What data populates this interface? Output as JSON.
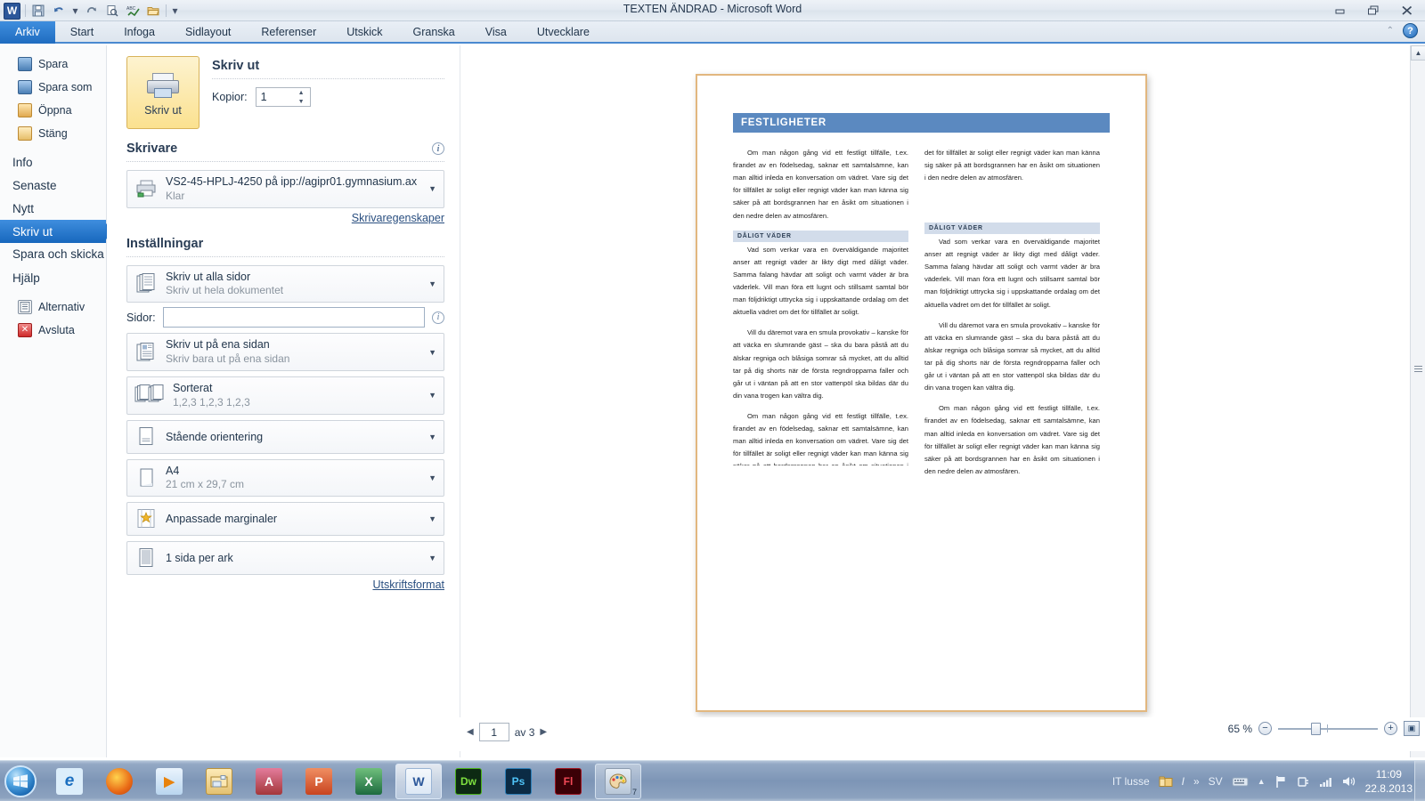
{
  "window": {
    "title": "TEXTEN ÄNDRAD  -  Microsoft Word",
    "minimize_label": "—",
    "restore_label": "❐",
    "close_label": "✕",
    "collapse_ribbon_label": "⌃",
    "help_label": "?"
  },
  "quick_access": {
    "app_logo": "W",
    "items": [
      {
        "name": "save-icon",
        "glyph": "💾"
      },
      {
        "name": "undo-icon",
        "glyph": "↶"
      },
      {
        "name": "undo-dropdown-icon",
        "glyph": "▾"
      },
      {
        "name": "redo-icon",
        "glyph": "↻"
      },
      {
        "name": "print-preview-icon",
        "glyph": "🔍"
      },
      {
        "name": "spelling-icon",
        "glyph": "ABC"
      },
      {
        "name": "open-icon",
        "glyph": "📂"
      },
      {
        "name": "customize-qat-icon",
        "glyph": "▾"
      }
    ]
  },
  "ribbon": {
    "tabs": [
      {
        "label": "Arkiv",
        "active": true
      },
      {
        "label": "Start",
        "active": false
      },
      {
        "label": "Infoga",
        "active": false
      },
      {
        "label": "Sidlayout",
        "active": false
      },
      {
        "label": "Referenser",
        "active": false
      },
      {
        "label": "Utskick",
        "active": false
      },
      {
        "label": "Granska",
        "active": false
      },
      {
        "label": "Visa",
        "active": false
      },
      {
        "label": "Utvecklare",
        "active": false
      }
    ]
  },
  "leftnav": {
    "items": [
      {
        "label": "Spara",
        "icon": "save-icon",
        "style": "small",
        "selected": false
      },
      {
        "label": "Spara som",
        "icon": "save-as-icon",
        "style": "small",
        "selected": false
      },
      {
        "label": "Öppna",
        "icon": "open-folder-icon",
        "style": "small",
        "selected": false
      },
      {
        "label": "Stäng",
        "icon": "close-folder-icon",
        "style": "small",
        "selected": false
      },
      {
        "label": "Info",
        "icon": "",
        "style": "big",
        "selected": false
      },
      {
        "label": "Senaste",
        "icon": "",
        "style": "big",
        "selected": false
      },
      {
        "label": "Nytt",
        "icon": "",
        "style": "big",
        "selected": false
      },
      {
        "label": "Skriv ut",
        "icon": "",
        "style": "big",
        "selected": true
      },
      {
        "label": "Spara och skicka",
        "icon": "",
        "style": "big",
        "selected": false
      },
      {
        "label": "Hjälp",
        "icon": "",
        "style": "big",
        "selected": false
      },
      {
        "label": "Alternativ",
        "icon": "options-icon",
        "style": "small",
        "selected": false
      },
      {
        "label": "Avsluta",
        "icon": "exit-icon",
        "style": "small",
        "selected": false
      }
    ]
  },
  "print": {
    "button_label": "Skriv ut",
    "section_title": "Skriv ut",
    "copies_label": "Kopior:",
    "copies_value": "1",
    "printer_section": "Skrivare",
    "printer_name": "VS2-45-HPLJ-4250 på ipp://agipr01.gymnasium.ax",
    "printer_status": "Klar",
    "printer_properties_link": "Skrivaregenskaper",
    "settings_section": "Inställningar",
    "pages_label": "Sidor:",
    "pages_value": "",
    "page_setup_link": "Utskriftsformat",
    "options": [
      {
        "main": "Skriv ut alla sidor",
        "sub": "Skriv ut hela dokumentet",
        "icon": "pages-stack-icon"
      },
      {
        "main": "Skriv ut på ena sidan",
        "sub": "Skriv bara ut på ena sidan",
        "icon": "one-sided-icon"
      },
      {
        "main": "Sorterat",
        "sub": "1,2,3   1,2,3   1,2,3",
        "icon": "collate-icon"
      },
      {
        "main": "Stående orientering",
        "sub": "",
        "icon": "portrait-icon"
      },
      {
        "main": "A4",
        "sub": "21 cm x 29,7 cm",
        "icon": "paper-size-icon"
      },
      {
        "main": "Anpassade marginaler",
        "sub": "",
        "icon": "margins-icon"
      },
      {
        "main": "1 sida per ark",
        "sub": "",
        "icon": "pages-per-sheet-icon"
      }
    ]
  },
  "document": {
    "heading": "FESTLIGHETER",
    "subheading": "DÅLIGT VÄDER",
    "paragraphs": {
      "festligheter": "Om man någon gång vid ett festligt tillfälle, t.ex. firandet av en födelsedag, saknar ett samtalsämne, kan man alltid inleda en konversation om vädret. Vare sig det för tillfället är soligt eller regnigt väder kan man känna sig säker på att bordsgrannen har en åsikt om situationen i den nedre delen av atmosfären.",
      "daligt_vader": "Vad som verkar vara en överväldigande majoritet anser att regnigt väder är likty digt med dåligt väder. Samma falang hävdar att soligt och varmt väder är bra väderlek. Vill man föra ett lugnt och stillsamt samtal bör man följdriktigt uttrycka sig i uppskattande ordalag om det aktuella vädret om det för tillfället är soligt.",
      "provokativ": "Vill du däremot vara en smula provokativ – kanske för att väcka en slumrande gäst – ska du bara påstå att du älskar regniga och blåsiga somrar så mycket, att du alltid tar på dig shorts när de första regndropparna faller och går ut i väntan på att en stor vattenpöl ska bildas där du din vana trogen kan vältra dig."
    }
  },
  "statusbar": {
    "page_current": "1",
    "page_total_label": "av 3",
    "prev_label": "◀",
    "next_label": "▶",
    "zoom_percent": "65 %",
    "zoom_out_label": "−",
    "zoom_in_label": "+",
    "fit_page_label": "▣"
  },
  "taskbar": {
    "start_label": "⊞",
    "apps": [
      {
        "name": "internet-explorer-icon",
        "glyph": "e",
        "bg": "#e8f3fd",
        "fg": "#2a79c4",
        "active": false
      },
      {
        "name": "firefox-icon",
        "glyph": "🦊",
        "bg": "#e98a23",
        "fg": "#fff",
        "active": false
      },
      {
        "name": "media-player-icon",
        "glyph": "▶",
        "bg": "#dbeaf8",
        "fg": "#e8820c",
        "active": false
      },
      {
        "name": "file-explorer-icon",
        "glyph": "🗂",
        "bg": "#f4dfa4",
        "fg": "#8a6a1c",
        "active": false
      },
      {
        "name": "access-icon",
        "glyph": "A",
        "bg": "#a4373a",
        "fg": "#fff",
        "active": false
      },
      {
        "name": "powerpoint-icon",
        "glyph": "P",
        "bg": "#d24726",
        "fg": "#fff",
        "active": false
      },
      {
        "name": "excel-icon",
        "glyph": "X",
        "bg": "#217346",
        "fg": "#fff",
        "active": false
      },
      {
        "name": "word-icon",
        "glyph": "W",
        "bg": "#2b579a",
        "fg": "#fff",
        "active": true
      },
      {
        "name": "dreamweaver-icon",
        "glyph": "Dw",
        "bg": "#0d2a13",
        "fg": "#7ee03f",
        "active": false
      },
      {
        "name": "photoshop-icon",
        "glyph": "Ps",
        "bg": "#0b2b45",
        "fg": "#4fc3f7",
        "active": false
      },
      {
        "name": "flash-icon",
        "glyph": "Fl",
        "bg": "#3b0006",
        "fg": "#f24957",
        "active": false
      },
      {
        "name": "paint-icon",
        "glyph": "🎨",
        "bg": "#cfd9e5",
        "fg": "#6b4a2a",
        "active": false,
        "badge": "7"
      }
    ],
    "tray": {
      "user_label": "IT lusse",
      "folder_icon": "📁",
      "info_icon": "I",
      "overflow_icon": "»",
      "language": "SV",
      "keyboard_icon": "⌨",
      "show_hidden_icon": "▲",
      "flag_icon": "⚑",
      "power_icon": "🔌",
      "network_icon": "▁▃▅",
      "volume_icon": "🔊",
      "time": "11:09",
      "date": "22.8.2013"
    }
  },
  "colors": {
    "accent_blue": "#2573c6",
    "heading_blue": "#5b89c0",
    "subheading_blue": "#d2dcea",
    "page_border": "#e2b77f",
    "print_button": "#fbe18f"
  }
}
